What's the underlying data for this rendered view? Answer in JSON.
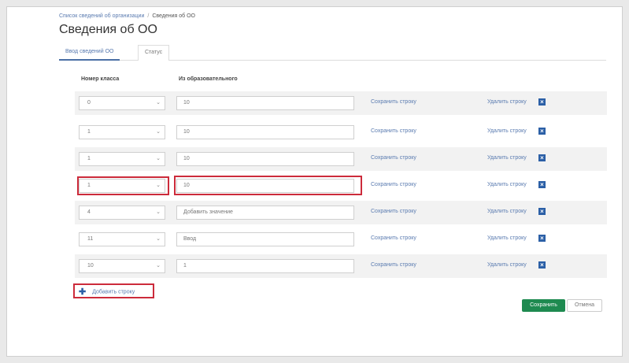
{
  "breadcrumb": {
    "parent": "Список сведений об организации",
    "current": "Сведения об ОО"
  },
  "page": {
    "title": "Сведения об ОО"
  },
  "tabs": [
    {
      "label": "Ввод сведений ОО"
    },
    {
      "label": "Статус"
    }
  ],
  "table": {
    "columns": [
      "Номер класса",
      "Из образовательного"
    ],
    "rows": [
      {
        "select": "0",
        "input": "10",
        "link": "Сохранить строку",
        "delete_label": "Удалить строку"
      },
      {
        "select": "1",
        "input": "10",
        "link": "Сохранить строку",
        "delete_label": "Удалить строку"
      },
      {
        "select": "1",
        "input": "10",
        "link": "Сохранить строку",
        "delete_label": "Удалить строку"
      },
      {
        "select": "1",
        "input": "10",
        "link": "Сохранить строку",
        "delete_label": "Удалить строку"
      },
      {
        "select": "4",
        "input": "Добавить значение",
        "link": "Сохранить строку",
        "delete_label": "Удалить строку"
      },
      {
        "select": "11",
        "input": "Ввод",
        "link": "Сохранить строку",
        "delete_label": "Удалить строку"
      },
      {
        "select": "10",
        "input": "1",
        "link": "Сохранить строку",
        "delete_label": "Удалить строку"
      }
    ]
  },
  "add_row": {
    "label": "Добавить строку"
  },
  "buttons": {
    "save": "Сохранить",
    "cancel": "Отмена"
  },
  "colors": {
    "highlight": "#cc2b3b",
    "save_button": "#1e8a50",
    "link": "#5a7bb0",
    "delete_icon": "#2b5fa6"
  }
}
